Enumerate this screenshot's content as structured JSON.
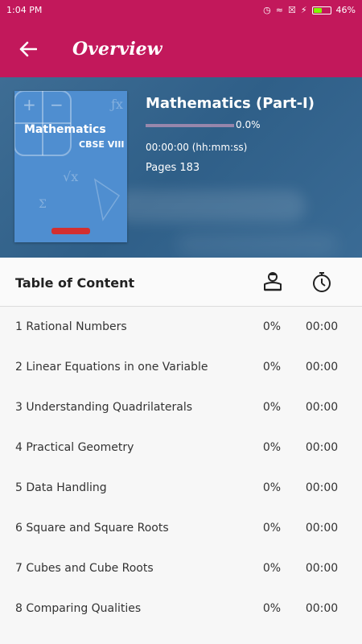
{
  "status_bar": {
    "time": "1:04 PM",
    "battery": "46%"
  },
  "app_bar": {
    "title": "Overview"
  },
  "book": {
    "cover_title": "Mathematics",
    "cover_subtitle": "CBSE VIII",
    "title": "Mathematics (Part-I)",
    "progress_text": "0.0%",
    "progress_fraction": 0.0,
    "time_spent": "00:00:00 (hh:mm:ss)",
    "pages": "Pages 183"
  },
  "toc": {
    "title": "Table of Content",
    "rows": [
      {
        "label": "1 Rational Numbers",
        "percent": "0%",
        "time": "00:00"
      },
      {
        "label": "2 Linear Equations in one Variable",
        "percent": "0%",
        "time": "00:00"
      },
      {
        "label": "3 Understanding Quadrilaterals",
        "percent": "0%",
        "time": "00:00"
      },
      {
        "label": "4 Practical Geometry",
        "percent": "0%",
        "time": "00:00"
      },
      {
        "label": "5 Data Handling",
        "percent": "0%",
        "time": "00:00"
      },
      {
        "label": "6 Square and Square Roots",
        "percent": "0%",
        "time": "00:00"
      },
      {
        "label": "7 Cubes and Cube Roots",
        "percent": "0%",
        "time": "00:00"
      },
      {
        "label": "8 Comparing Qualities",
        "percent": "0%",
        "time": "00:00"
      }
    ]
  },
  "colors": {
    "app_bar": "#c2185b",
    "hero": "#35628b",
    "cover": "#4f8ed0"
  },
  "icons": {
    "back": "arrow-left-icon",
    "reader": "reader-icon",
    "timer": "stopwatch-icon"
  }
}
